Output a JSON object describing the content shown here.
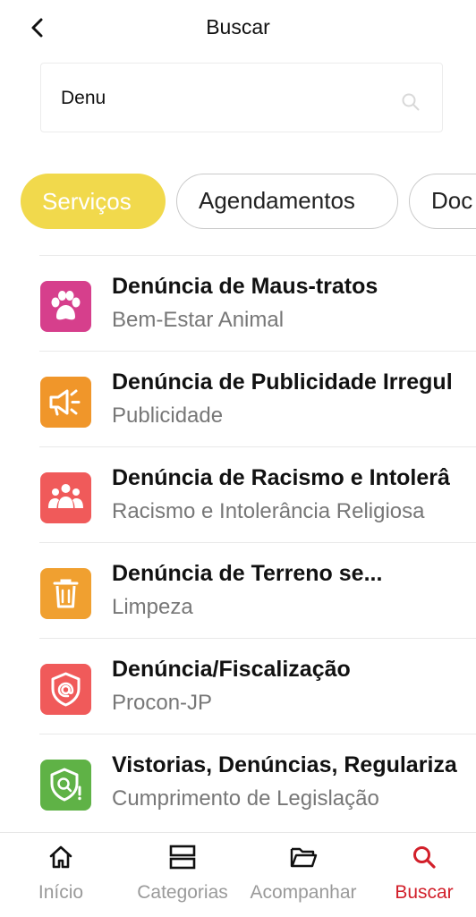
{
  "header": {
    "title": "Buscar",
    "back_icon": "chevron-left-icon"
  },
  "search": {
    "value": "Denu",
    "icon": "search-icon"
  },
  "filters": [
    {
      "label": "Serviços",
      "active": true
    },
    {
      "label": "Agendamentos",
      "active": false
    },
    {
      "label": "Doc",
      "active": false
    }
  ],
  "results": [
    {
      "title": "Denúncia de Maus-tratos",
      "subtitle": "Bem-Estar Animal",
      "icon": "paw-icon",
      "color": "#d63f8c"
    },
    {
      "title": "Denúncia de Publicidade Irregul",
      "subtitle": "Publicidade",
      "icon": "megaphone-icon",
      "color": "#f0962a"
    },
    {
      "title": "Denúncia de Racismo e Intolerâ",
      "subtitle": "Racismo e Intolerância Religiosa",
      "icon": "people-icon",
      "color": "#f05a5a"
    },
    {
      "title": "Denúncia de Terreno se...",
      "subtitle": "Limpeza",
      "icon": "trash-icon",
      "color": "#f0a030"
    },
    {
      "title": "Denúncia/Fiscalização",
      "subtitle": "Procon-JP",
      "icon": "shield-at-icon",
      "color": "#f05a5a"
    },
    {
      "title": "Vistorias, Denúncias, Regulariza",
      "subtitle": "Cumprimento de Legislação",
      "icon": "shield-search-icon",
      "color": "#5fb246"
    }
  ],
  "nav": [
    {
      "label": "Início",
      "icon": "home-icon",
      "active": false
    },
    {
      "label": "Categorias",
      "icon": "categories-icon",
      "active": false
    },
    {
      "label": "Acompanhar",
      "icon": "folder-icon",
      "active": false
    },
    {
      "label": "Buscar",
      "icon": "search-icon",
      "active": true
    }
  ],
  "colors": {
    "accent": "#f1d94c",
    "active_nav": "#d21f2a"
  }
}
